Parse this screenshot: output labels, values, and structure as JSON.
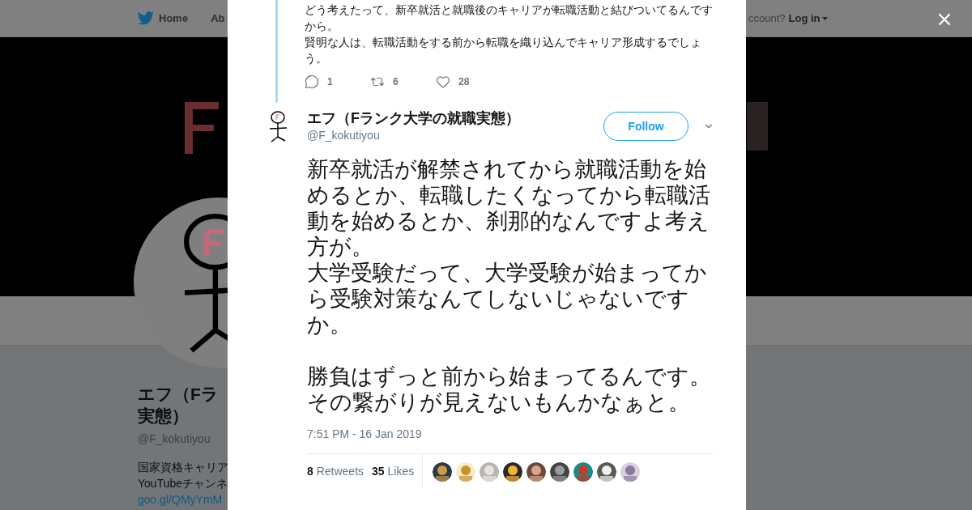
{
  "page_nav": {
    "items": [
      {
        "label": "Home"
      },
      {
        "label": "Ab"
      }
    ],
    "account_prompt": "ccount?",
    "login": "Log in"
  },
  "profile": {
    "name_lines": [
      "エフ（Fラ",
      "実態）"
    ],
    "handle": "@F_kokutiyou",
    "bio_lines": [
      {
        "kind": "text",
        "text": "国家資格キャリア"
      },
      {
        "kind": "text",
        "text": "YouTubeチャンネ"
      },
      {
        "kind": "link",
        "text": "goo.gl/QMyYmM"
      }
    ]
  },
  "context_tweet": {
    "lines": [
      "どう考えたって、新卒就活と就職後のキャリアが転職活動と結びついてるんですから。",
      "賢明な人は、転職活動をする前から転職を織り込んでキャリア形成するでしょう。"
    ],
    "actions": [
      {
        "kind": "reply",
        "count": "1"
      },
      {
        "kind": "retweet",
        "count": "6"
      },
      {
        "kind": "like",
        "count": "28"
      }
    ]
  },
  "tweet": {
    "name": "エフ（Fランク大学の就職実態）",
    "handle": "@F_kokutiyou",
    "follow_button": "Follow",
    "text_blocks": [
      [
        "新卒就活が解禁されてから就職活動を始めるとか、転職したくなってから転職活動を始めるとか、刹那的なんですよ考え方が。",
        "大学受験だって、大学受験が始まってから受験対策なんてしないじゃないですか。"
      ],
      [
        "勝負はずっと前から始まってるんです。",
        "その繋がりが見えないもんかなぁと。"
      ]
    ],
    "timestamp": "7:51 PM - 16 Jan 2019",
    "stats": [
      {
        "count": "8",
        "label": "Retweets"
      },
      {
        "count": "35",
        "label": "Likes"
      }
    ],
    "liked_by": [
      {
        "kind": "picture"
      },
      {
        "kind": "picture"
      },
      {
        "kind": "picture"
      },
      {
        "kind": "picture"
      },
      {
        "kind": "picture"
      },
      {
        "kind": "picture"
      },
      {
        "kind": "picture"
      },
      {
        "kind": "picture"
      },
      {
        "kind": "picture"
      }
    ]
  }
}
